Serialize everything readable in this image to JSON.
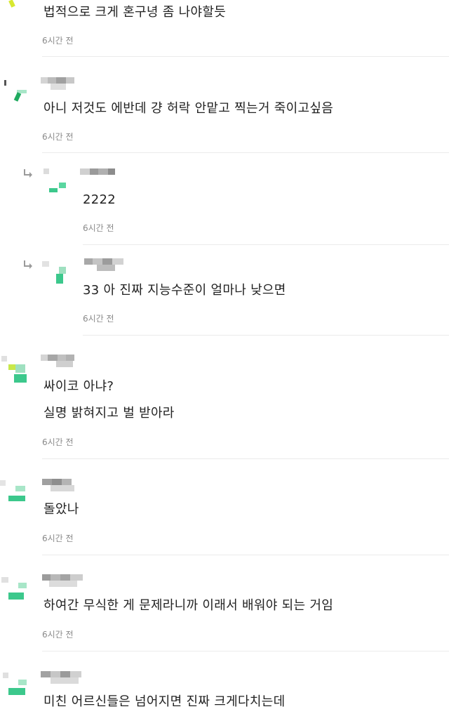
{
  "comments": [
    {
      "id": "c1",
      "lines": [
        "법적으로 크게 혼구녕 좀 나야할듯"
      ],
      "time": "6시간 전",
      "is_reply": false
    },
    {
      "id": "c2",
      "lines": [
        "아니 저것도 에반데 걍 허락 안맡고 찍는거 죽이고싶음"
      ],
      "time": "6시간 전",
      "is_reply": false
    },
    {
      "id": "c3",
      "lines": [
        "2222"
      ],
      "time": "6시간 전",
      "is_reply": true
    },
    {
      "id": "c4",
      "lines": [
        "33 아 진짜 지능수준이 얼마나 낮으면"
      ],
      "time": "6시간 전",
      "is_reply": true
    },
    {
      "id": "c5",
      "lines": [
        "싸이코 아냐?",
        "실명 밝혀지고 벌 받아라"
      ],
      "time": "6시간 전",
      "is_reply": false
    },
    {
      "id": "c6",
      "lines": [
        "돌았나"
      ],
      "time": "6시간 전",
      "is_reply": false
    },
    {
      "id": "c7",
      "lines": [
        "하여간 무식한 게 문제라니까 이래서 배워야 되는 거임"
      ],
      "time": "6시간 전",
      "is_reply": false
    },
    {
      "id": "c8",
      "lines": [
        "미친 어르신들은 넘어지면 진짜 크게다치는데"
      ],
      "time": "",
      "is_reply": false
    }
  ],
  "colors": {
    "avatar_green": "#3cc88c",
    "avatar_green_light": "#a8e6c8",
    "avatar_yellow": "#d8e830",
    "nick_gray_dark": "#9a9a9a",
    "nick_gray_light": "#d4d4d4",
    "time_gray": "#8a8a8a",
    "divider": "#ebebeb"
  },
  "icons": {
    "reply": "reply-arrow-icon",
    "avatar": "avatar-icon"
  }
}
